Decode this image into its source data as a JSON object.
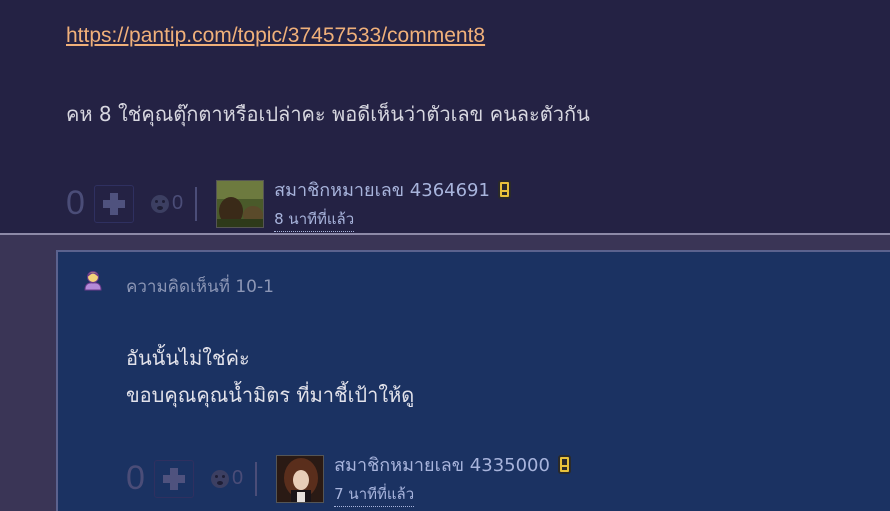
{
  "top_comment": {
    "link_text": "https://pantip.com/topic/37457533/comment8",
    "body": "คห 8   ใช่คุณตุ๊กตาหรือเปล่าคะ  พอดีเห็นว่าตัวเลข คนละตัวกัน",
    "score": "0",
    "emotion_count": "0",
    "member_name": "สมาชิกหมายเลข 4364691",
    "time_ago": "8 นาทีที่แล้ว",
    "avatar_icon": "avatar-landscape-photo",
    "device_icon": "mobile-phone-icon"
  },
  "reply": {
    "label": "ความคิดเห็นที่ 10-1",
    "icon": "user-avatar-icon",
    "lines": [
      "อันนั้นไม่ใช่ค่ะ",
      "ขอบคุณคุณน้ำมิตร ที่มาชี้เป้าให้ดู"
    ],
    "score": "0",
    "emotion_count": "0",
    "member_name": "สมาชิกหมายเลข 4335000",
    "time_ago": "7 นาทีที่แล้ว",
    "avatar_icon": "avatar-doll-photo",
    "device_icon": "mobile-phone-icon"
  },
  "colors": {
    "top_bg": "#242244",
    "reply_bg": "#1b3262",
    "link": "#f0b07a",
    "member": "#a8b4dc"
  }
}
